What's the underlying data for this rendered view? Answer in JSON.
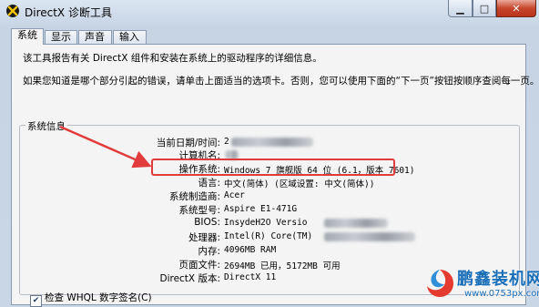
{
  "window": {
    "title": "DirectX 诊断工具",
    "minimize_glyph": "▁",
    "maximize_glyph": "□",
    "close_glyph": "✕"
  },
  "tabs": [
    {
      "label": "系统",
      "active": true
    },
    {
      "label": "显示",
      "active": false
    },
    {
      "label": "声音",
      "active": false
    },
    {
      "label": "输入",
      "active": false
    }
  ],
  "intro": {
    "line1": "该工具报告有关 DirectX 组件和安装在系统上的驱动程序的详细信息。",
    "line2": "如果您知道是哪个部分引起的错误，请单击上面适当的选项卡。否则，您可以使用下面的“下一页”按钮按顺序查阅每一页。"
  },
  "system_info": {
    "group_title": "系统信息",
    "rows": [
      {
        "label": "当前日期/时间:",
        "value": "2"
      },
      {
        "label": "计算机名:",
        "value": ""
      },
      {
        "label": "操作系统:",
        "value": "Windows 7 旗舰版 64 位 (6.1，版本 7601)"
      },
      {
        "label": "语言:",
        "value": "中文(简体) (区域设置: 中文(简体))"
      },
      {
        "label": "系统制造商:",
        "value": "Acer"
      },
      {
        "label": "系统型号:",
        "value": "Aspire E1-471G"
      },
      {
        "label": "BIOS:",
        "value": "InsydeH2O Versio"
      },
      {
        "label": "处理器:",
        "value": "Intel(R) Core(TM)"
      },
      {
        "label": "内存:",
        "value": "4096MB RAM"
      },
      {
        "label": "页面文件:",
        "value": "2694MB 已用，5172MB 可用"
      },
      {
        "label": "DirectX 版本:",
        "value": "DirectX 11"
      }
    ]
  },
  "whql_check": {
    "label": "检查 WHQL 数字签名(C)",
    "checked": true
  },
  "watermark": {
    "brand": "鹏鑫装机网",
    "url": "www.0753px.com"
  },
  "colors": {
    "annotation_red": "#e23b3b",
    "watermark_blue": "#1b6fb8"
  }
}
